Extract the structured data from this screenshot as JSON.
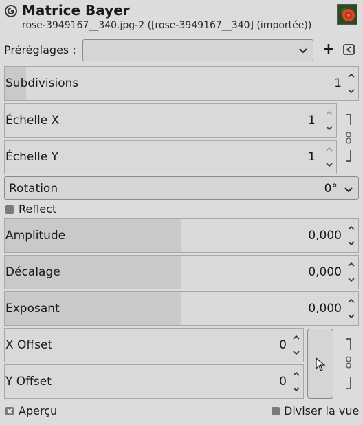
{
  "header": {
    "title": "Matrice Bayer",
    "subtitle": "rose-3949167__340.jpg-2 ([rose-3949167__340] (importée))"
  },
  "presets": {
    "label": "Préréglages :",
    "value": ""
  },
  "fields": {
    "subdivisions": {
      "label": "Subdivisions",
      "value": "1",
      "fill": 0.06
    },
    "scale_x": {
      "label": "Échelle X",
      "value": "1",
      "fill": 0.0
    },
    "scale_y": {
      "label": "Échelle Y",
      "value": "1",
      "fill": 0.0
    },
    "rotation": {
      "label": "Rotation",
      "value": "0°"
    },
    "amplitude": {
      "label": "Amplitude",
      "value": "0,000",
      "fill": 0.5
    },
    "offset": {
      "label": "Décalage",
      "value": "0,000",
      "fill": 0.5
    },
    "exponent": {
      "label": "Exposant",
      "value": "0,000",
      "fill": 0.5
    },
    "x_offset": {
      "label": "X Offset",
      "value": "0",
      "fill": 0.0
    },
    "y_offset": {
      "label": "Y Offset",
      "value": "0",
      "fill": 0.0
    }
  },
  "reflect": {
    "label": "Reflect",
    "checked": false
  },
  "footer": {
    "preview_label": "Aperçu",
    "preview_checked": true,
    "split_label": "Diviser la vue",
    "split_checked": false
  },
  "colors": {
    "background": "#dcdcdc",
    "field": "#d9d9d9",
    "field_fill": "#c9c9c9"
  }
}
